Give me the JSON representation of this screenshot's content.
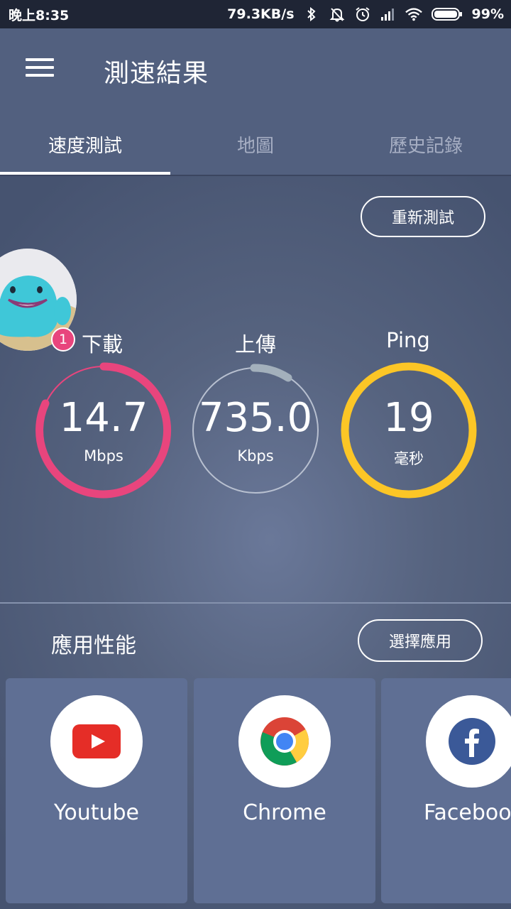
{
  "status_bar": {
    "time": "晚上8:35",
    "net_speed": "79.3KB/s",
    "battery": "99%"
  },
  "app_bar": {
    "title": "測速結果"
  },
  "tabs": [
    {
      "label": "速度測試",
      "active": true
    },
    {
      "label": "地圖",
      "active": false
    },
    {
      "label": "歷史記錄",
      "active": false
    }
  ],
  "retest_label": "重新測試",
  "notification_count": "1",
  "metrics": {
    "download": {
      "label": "下載",
      "value": "14.7",
      "unit": "Mbps",
      "color": "#e8457d"
    },
    "upload": {
      "label": "上傳",
      "value": "735.0",
      "unit": "Kbps",
      "color": "#a3b0bc"
    },
    "ping": {
      "label": "Ping",
      "value": "19",
      "unit": "毫秒",
      "color": "#fcc626"
    }
  },
  "app_performance": {
    "title": "應用性能",
    "choose_label": "選擇應用",
    "apps": [
      {
        "name": "Youtube",
        "icon": "youtube-icon"
      },
      {
        "name": "Chrome",
        "icon": "chrome-icon"
      },
      {
        "name": "Facebook",
        "icon": "facebook-icon"
      }
    ]
  }
}
